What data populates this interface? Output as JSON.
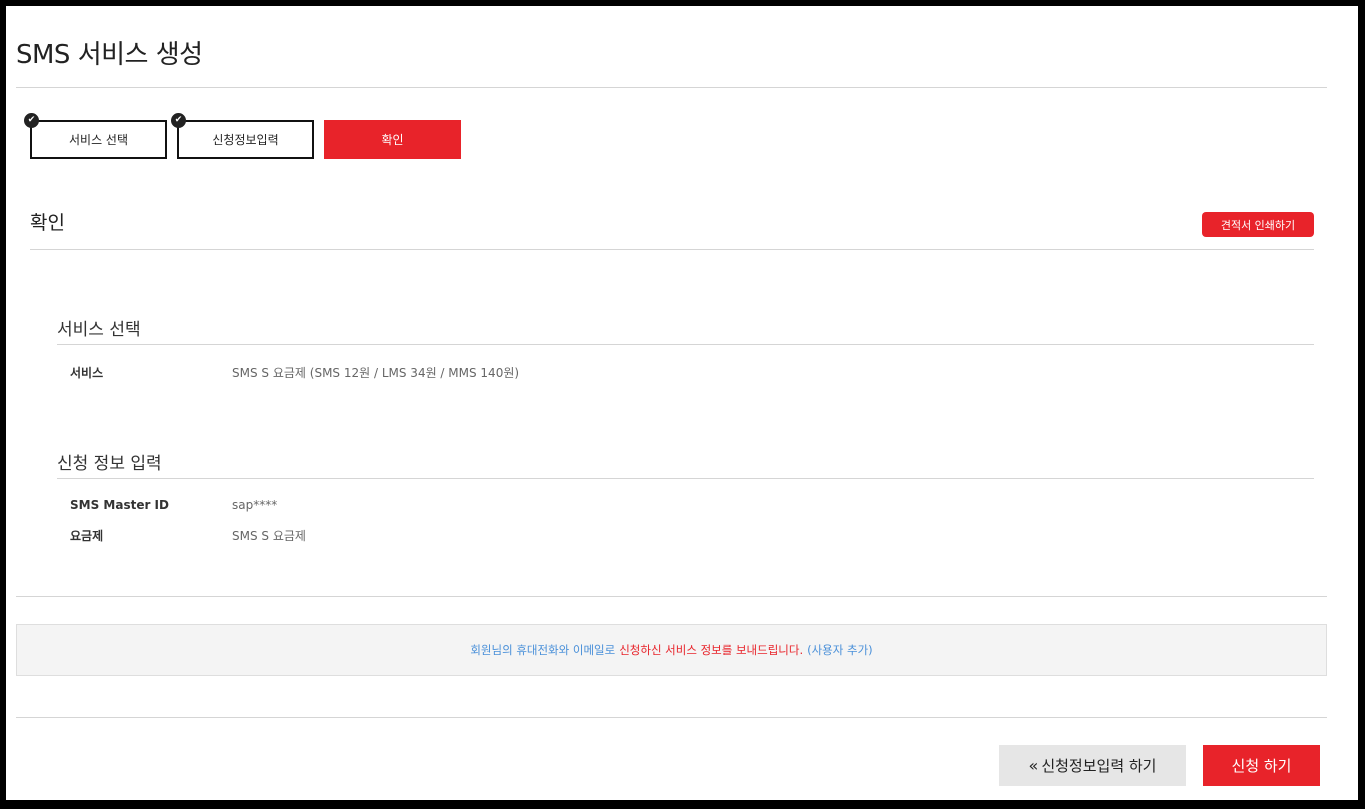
{
  "page": {
    "title": "SMS 서비스 생성"
  },
  "steps": [
    {
      "label": "서비스 선택",
      "status": "done"
    },
    {
      "label": "신청정보입력",
      "status": "done"
    },
    {
      "label": "확인",
      "status": "active"
    }
  ],
  "confirm": {
    "title": "확인",
    "print_label": "견적서 인쇄하기"
  },
  "service_section": {
    "title": "서비스 선택",
    "rows": [
      {
        "key": "서비스",
        "value": "SMS S 요금제 (SMS 12원 / LMS 34원 / MMS 140원)"
      }
    ]
  },
  "info_section": {
    "title": "신청 정보 입력",
    "rows": [
      {
        "key": "SMS Master ID",
        "value": "sap****"
      },
      {
        "key": "요금제",
        "value": "SMS S 요금제"
      }
    ]
  },
  "notice": {
    "part1": "회원님의 휴대전화와 이메일로",
    "part2": "신청하신 서비스 정보를 보내드립니다.",
    "link": "(사용자 추가)"
  },
  "actions": {
    "back_label": "신청정보입력 하기",
    "submit_label": "신청 하기"
  },
  "colors": {
    "accent": "#e8232a",
    "link": "#4a90d9"
  }
}
